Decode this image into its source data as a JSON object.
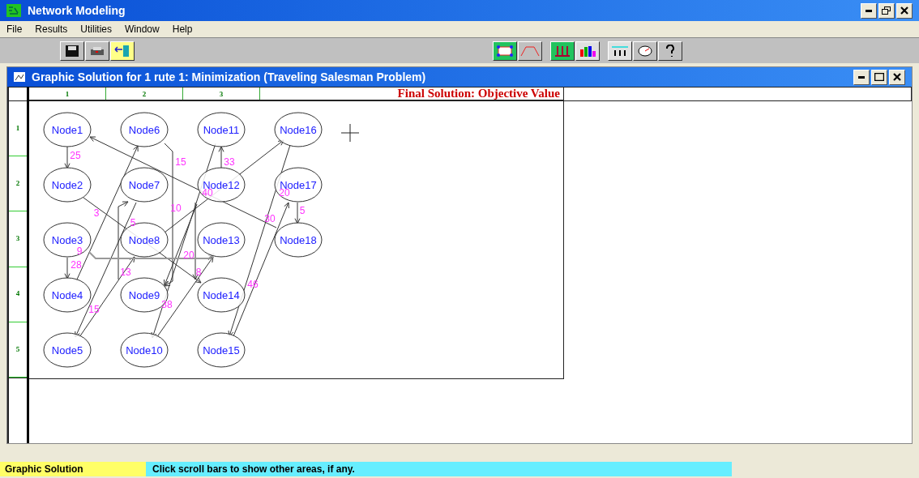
{
  "window": {
    "title": "Network Modeling"
  },
  "menu": [
    "File",
    "Results",
    "Utilities",
    "Window",
    "Help"
  ],
  "child_window": {
    "title": "Graphic Solution for 1 rute 1: Minimization (Traveling Salesman Problem)"
  },
  "grid": {
    "columns": [
      "1",
      "2",
      "3"
    ],
    "heading": "Final Solution: Objective Value",
    "rows": [
      "1",
      "2",
      "3",
      "4",
      "5"
    ]
  },
  "node_columns": [
    [
      {
        "label": "Node1"
      },
      {
        "label": "Node2"
      },
      {
        "label": "Node3"
      },
      {
        "label": "Node4"
      },
      {
        "label": "Node5"
      }
    ],
    [
      {
        "label": "Node6"
      },
      {
        "label": "Node7"
      },
      {
        "label": "Node8"
      },
      {
        "label": "Node9"
      },
      {
        "label": "Node10"
      }
    ],
    [
      {
        "label": "Node11"
      },
      {
        "label": "Node12"
      },
      {
        "label": "Node13"
      },
      {
        "label": "Node14"
      },
      {
        "label": "Node15"
      }
    ],
    [
      {
        "label": "Node16"
      },
      {
        "label": "Node17"
      },
      {
        "label": "Node18"
      }
    ]
  ],
  "edge_weights": [
    "25",
    "15",
    "33",
    "40",
    "20",
    "3",
    "10",
    "5",
    "5",
    "30",
    "9",
    "28",
    "20",
    "13",
    "8",
    "15",
    "38",
    "46"
  ],
  "status_bar": {
    "panel": "Graphic Solution",
    "message": "Click scroll bars to show other areas, if any."
  }
}
